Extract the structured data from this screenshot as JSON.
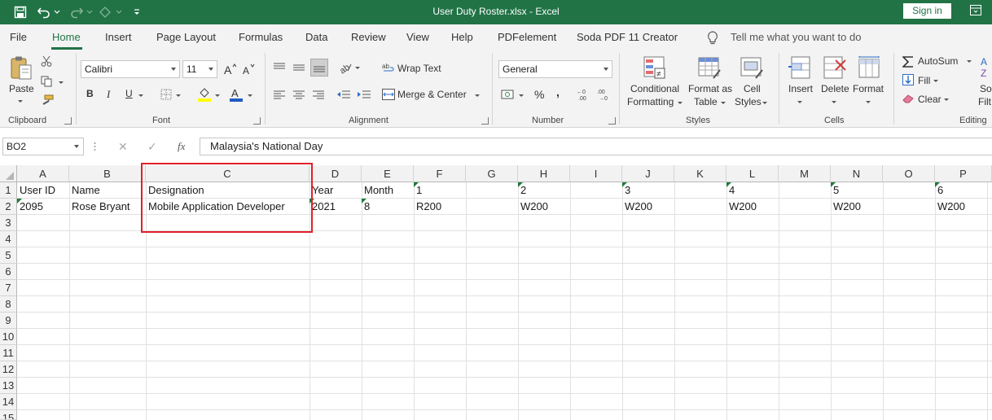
{
  "window": {
    "title": "User Duty Roster.xlsx  -  Excel",
    "sign_in": "Sign in"
  },
  "tabs": [
    {
      "label": "File"
    },
    {
      "label": "Home"
    },
    {
      "label": "Insert"
    },
    {
      "label": "Page Layout"
    },
    {
      "label": "Formulas"
    },
    {
      "label": "Data"
    },
    {
      "label": "Review"
    },
    {
      "label": "View"
    },
    {
      "label": "Help"
    },
    {
      "label": "PDFelement"
    },
    {
      "label": "Soda PDF 11 Creator"
    }
  ],
  "tell_me": "Tell me what you want to do",
  "ribbon": {
    "clipboard": {
      "paste": "Paste",
      "group": "Clipboard"
    },
    "font": {
      "name": "Calibri",
      "size": "11",
      "bold": "B",
      "italic": "I",
      "underline": "U",
      "group": "Font"
    },
    "alignment": {
      "wrap": "Wrap Text",
      "merge": "Merge & Center",
      "group": "Alignment"
    },
    "number": {
      "format": "General",
      "percent": "%",
      "comma": ",",
      "group": "Number"
    },
    "styles": {
      "conditional_1": "Conditional",
      "conditional_2": "Formatting",
      "format_as_1": "Format as",
      "format_as_2": "Table",
      "cell_styles_1": "Cell",
      "cell_styles_2": "Styles",
      "group": "Styles"
    },
    "cells": {
      "insert": "Insert",
      "delete": "Delete",
      "format": "Format",
      "group": "Cells"
    },
    "editing": {
      "autosum": "AutoSum",
      "fill": "Fill",
      "clear": "Clear",
      "sort_1": "So",
      "sort_2": "Filt",
      "group": "Editing"
    }
  },
  "formula_bar": {
    "name_box": "BO2",
    "cancel": "✕",
    "enter": "✓",
    "fx": "fx",
    "content": "Malaysia's National Day"
  },
  "columns": [
    "A",
    "B",
    "C",
    "D",
    "E",
    "F",
    "G",
    "H",
    "I",
    "J",
    "K",
    "L",
    "M",
    "N",
    "O",
    "P"
  ],
  "rows": [
    "1",
    "2",
    "3",
    "4",
    "5",
    "6",
    "7",
    "8",
    "9",
    "10",
    "11",
    "12",
    "13",
    "14",
    "15"
  ],
  "cells": {
    "A1": "User ID",
    "B1": "Name",
    "C1": "Designation",
    "D1": "Year",
    "E1": "Month",
    "F1": "1",
    "H1": "2",
    "J1": "3",
    "L1": "4",
    "N1": "5",
    "P1": "6",
    "A2": "2095",
    "B2": "Rose Bryant",
    "C2": "Mobile Application Developer",
    "D2": "2021",
    "E2": "8",
    "F2": "R200",
    "H2": "W200",
    "J2": "W200",
    "L2": "W200",
    "N2": "W200",
    "P2": "W200"
  },
  "colors": {
    "accent": "#217346",
    "highlight_box": "#e0202a"
  }
}
